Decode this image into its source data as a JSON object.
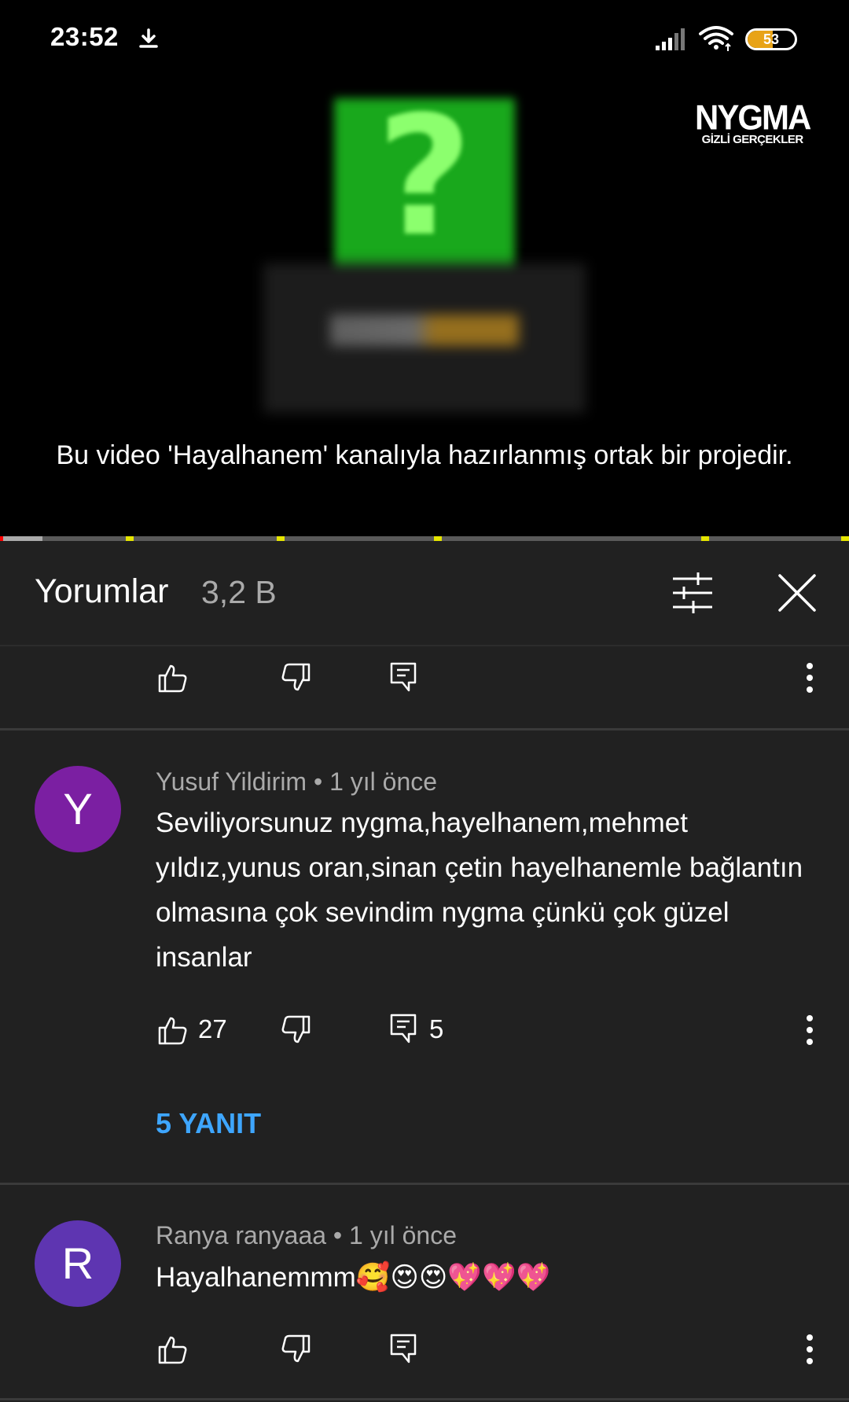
{
  "status_bar": {
    "time": "23:52",
    "battery": "53",
    "battery_level": 0.53
  },
  "video": {
    "brand_name": "NYGMA",
    "brand_sub": "GİZLİ GERÇEKLER",
    "caption": "Bu video 'Hayalhanem' kanalıyla hazırlanmış ortak bir projedir."
  },
  "comments_header": {
    "title": "Yorumlar",
    "count": "3,2 B"
  },
  "comments": [
    {
      "author": "Yusuf Yildirim",
      "age": "1 yıl önce",
      "avatar_letter": "Y",
      "avatar_color": "#7b1fa2",
      "text": "Seviliyorsunuz nygma,hayelhanem,mehmet yıldız,yunus oran,sinan çetin hayelhanemle bağlantın olmasına çok sevindim nygma çünkü çok güzel insanlar",
      "likes": "27",
      "reply_count": "5",
      "replies_label": "5 YANIT"
    },
    {
      "author": "Ranya ranyaaa",
      "age": "1 yıl önce",
      "avatar_letter": "R",
      "avatar_color": "#5e35b1",
      "text": "Hayalhanemmm🥰😍😍💖💖💖"
    }
  ],
  "meta_separator": "•",
  "icons": [
    "download-icon",
    "signal-icon",
    "wifi-icon",
    "battery-icon",
    "filter-icon",
    "close-icon",
    "like-icon",
    "dislike-icon",
    "reply-icon",
    "more-icon"
  ]
}
